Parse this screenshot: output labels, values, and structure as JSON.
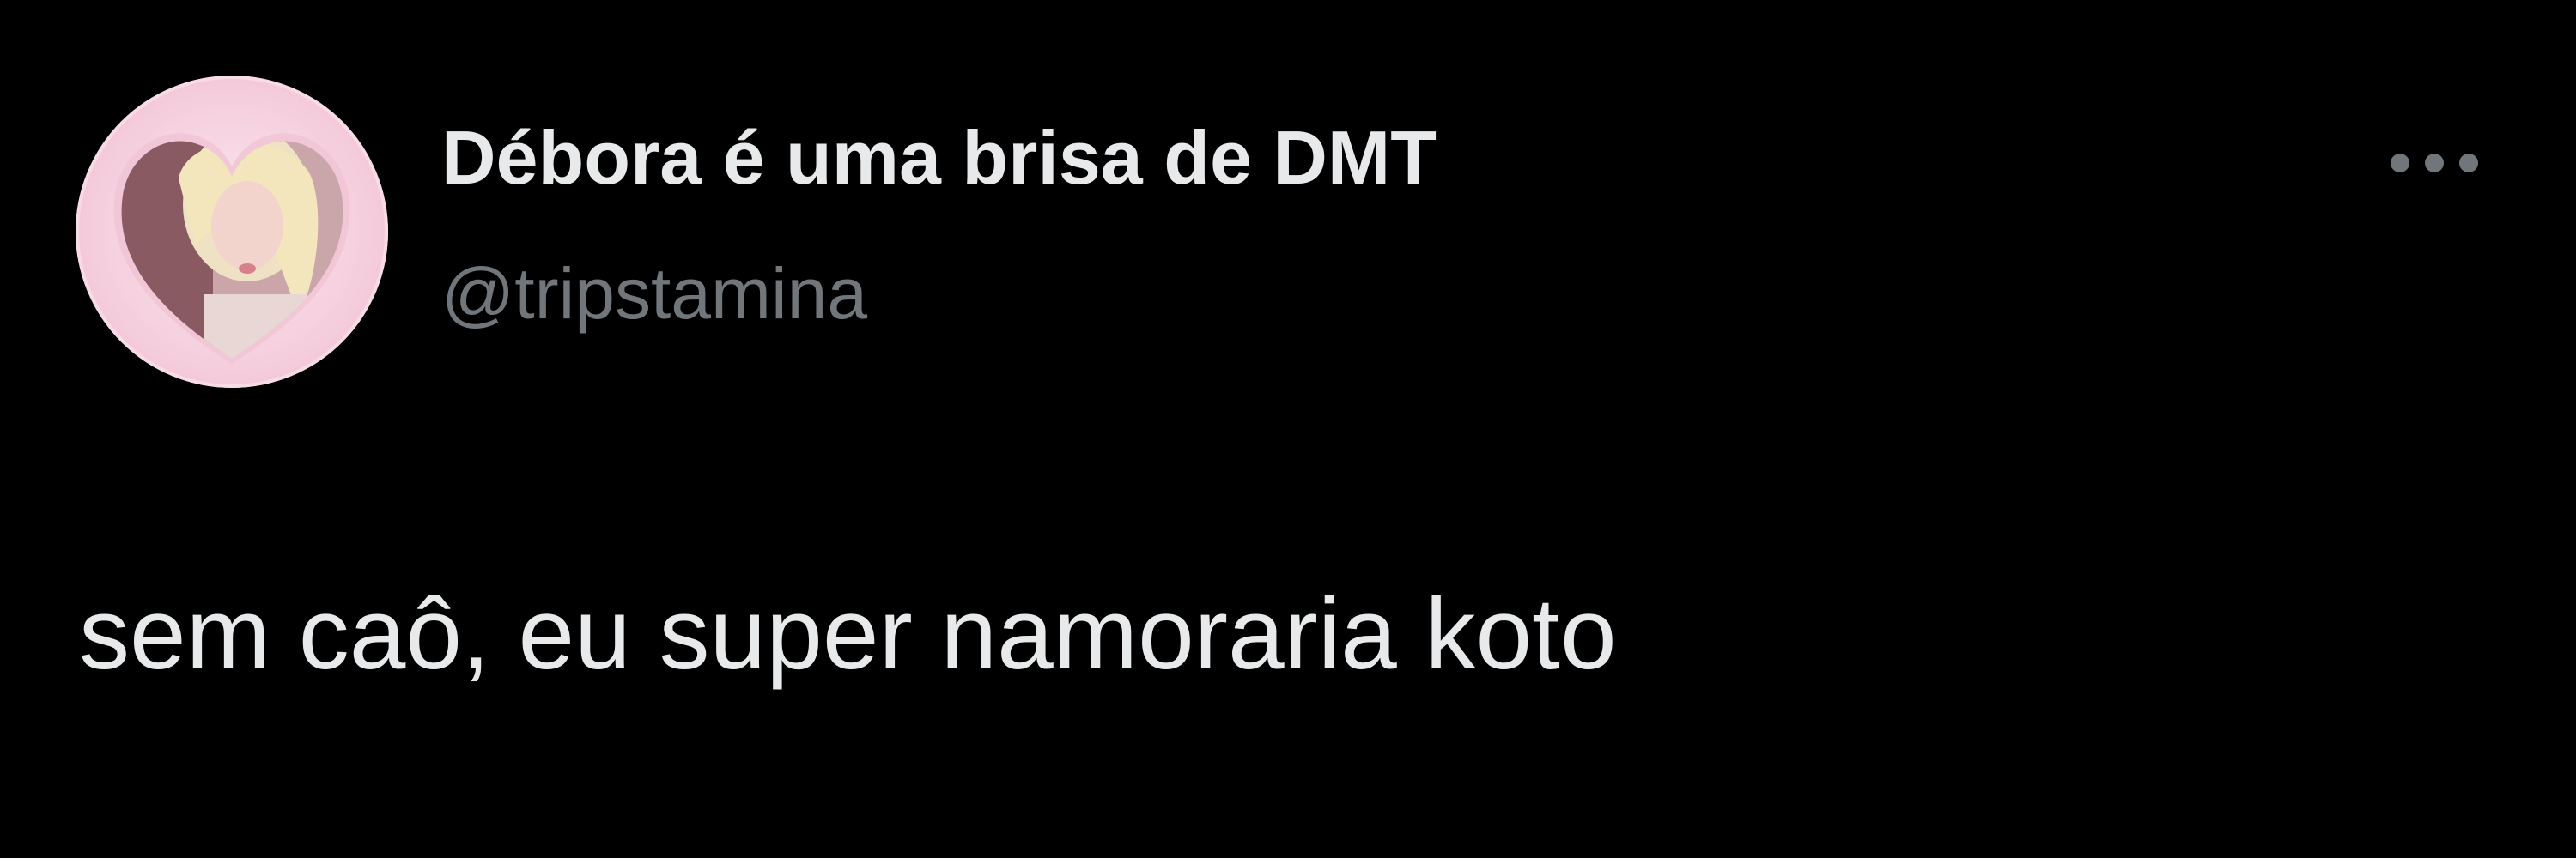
{
  "tweet": {
    "author": {
      "display_name": "Débora é uma brisa de DMT",
      "handle": "@tripstamina",
      "avatar_icon": "user-avatar-photo"
    },
    "more_icon": "more-options-icon",
    "text": "sem caô, eu super namoraria koto"
  },
  "colors": {
    "background": "#000000",
    "primary_text": "#e7e9ea",
    "secondary_text": "#71767b",
    "avatar_frame": "#f7dbe6"
  }
}
